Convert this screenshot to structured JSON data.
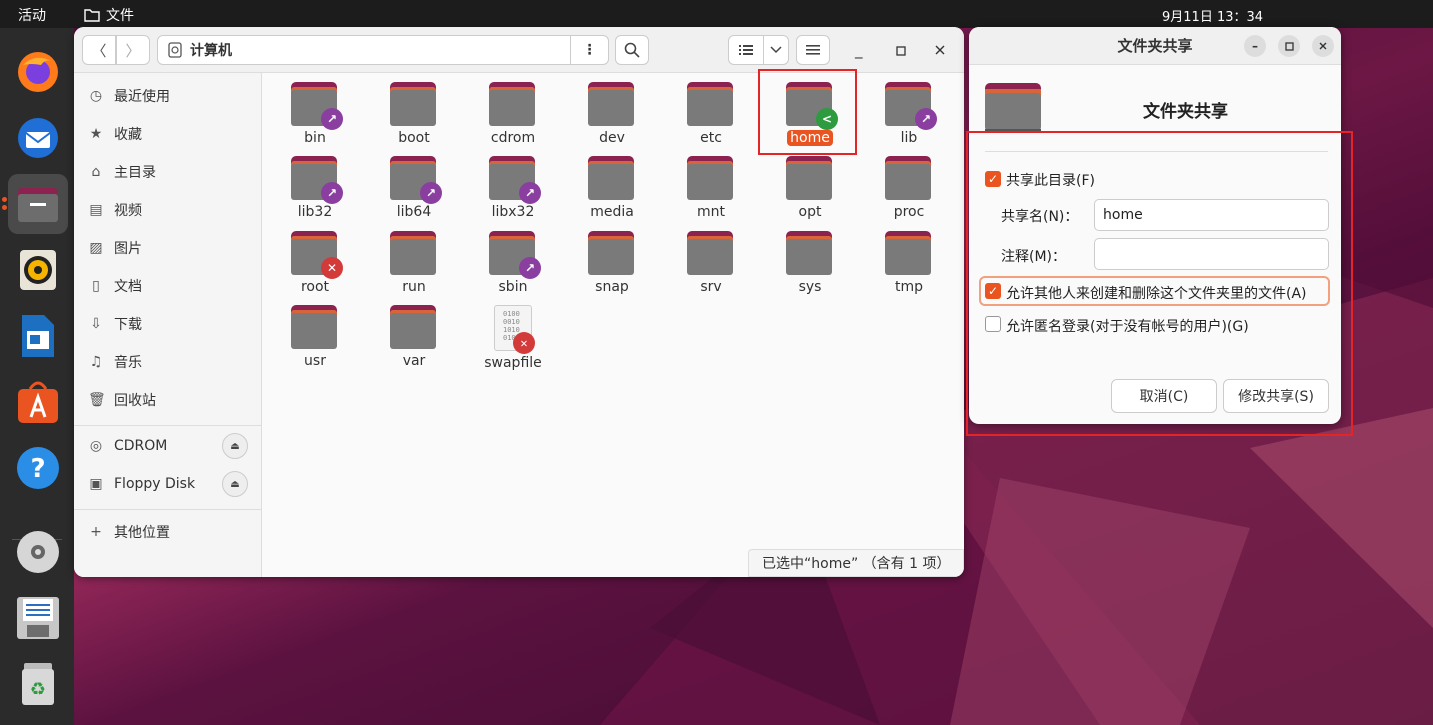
{
  "topbar": {
    "activities": "活动",
    "app_name": "文件",
    "clock": "9月11日  13：34"
  },
  "dock": {
    "items": [
      "firefox-icon",
      "thunderbird-icon",
      "files-icon",
      "rhythmbox-icon",
      "libreoffice-writer-icon",
      "app-center-icon",
      "help-icon",
      "cdrom-icon",
      "floppy-icon",
      "trash-icon"
    ]
  },
  "file_manager": {
    "path": "计算机",
    "sidebar": [
      {
        "label": "最近使用",
        "icon": "clock-icon"
      },
      {
        "label": "收藏",
        "icon": "star-icon"
      },
      {
        "label": "主目录",
        "icon": "home-icon"
      },
      {
        "label": "视频",
        "icon": "video-icon"
      },
      {
        "label": "图片",
        "icon": "picture-icon"
      },
      {
        "label": "文档",
        "icon": "document-icon"
      },
      {
        "label": "下载",
        "icon": "download-icon"
      },
      {
        "label": "音乐",
        "icon": "music-icon"
      },
      {
        "label": "回收站",
        "icon": "trash-icon"
      }
    ],
    "devices": [
      {
        "label": "CDROM",
        "icon": "cdrom-icon"
      },
      {
        "label": "Floppy Disk",
        "icon": "floppy-icon"
      }
    ],
    "other_locations": "其他位置",
    "files": [
      {
        "name": "bin",
        "emblem": "link"
      },
      {
        "name": "boot",
        "emblem": ""
      },
      {
        "name": "cdrom",
        "emblem": ""
      },
      {
        "name": "dev",
        "emblem": ""
      },
      {
        "name": "etc",
        "emblem": ""
      },
      {
        "name": "home",
        "emblem": "share",
        "selected": true
      },
      {
        "name": "lib",
        "emblem": "link"
      },
      {
        "name": "lib32",
        "emblem": "link"
      },
      {
        "name": "lib64",
        "emblem": "link"
      },
      {
        "name": "libx32",
        "emblem": "link"
      },
      {
        "name": "media",
        "emblem": ""
      },
      {
        "name": "mnt",
        "emblem": ""
      },
      {
        "name": "opt",
        "emblem": ""
      },
      {
        "name": "proc",
        "emblem": ""
      },
      {
        "name": "root",
        "emblem": "noaccess"
      },
      {
        "name": "run",
        "emblem": ""
      },
      {
        "name": "sbin",
        "emblem": "link"
      },
      {
        "name": "snap",
        "emblem": ""
      },
      {
        "name": "srv",
        "emblem": ""
      },
      {
        "name": "sys",
        "emblem": ""
      },
      {
        "name": "tmp",
        "emblem": ""
      },
      {
        "name": "usr",
        "emblem": ""
      },
      {
        "name": "var",
        "emblem": ""
      },
      {
        "name": "swapfile",
        "emblem": "noaccess",
        "type": "binary"
      }
    ],
    "status": "已选中“home” （含有 1 项）"
  },
  "share_dialog": {
    "window_title": "文件夹共享",
    "heading": "文件夹共享",
    "share_checkbox": "共享此目录(F)",
    "share_checked": true,
    "share_name_label": "共享名(N)：",
    "share_name_value": "home",
    "comment_label": "注释(M)：",
    "comment_value": "",
    "allow_others": "允许其他人来创建和删除这个文件夹里的文件(A)",
    "allow_others_checked": true,
    "guest_access": "允许匿名登录(对于没有帐号的用户)(G)",
    "guest_checked": false,
    "cancel": "取消(C)",
    "modify": "修改共享(S)"
  },
  "colors": {
    "accent": "#e95420",
    "highlight_box": "#e52525"
  }
}
